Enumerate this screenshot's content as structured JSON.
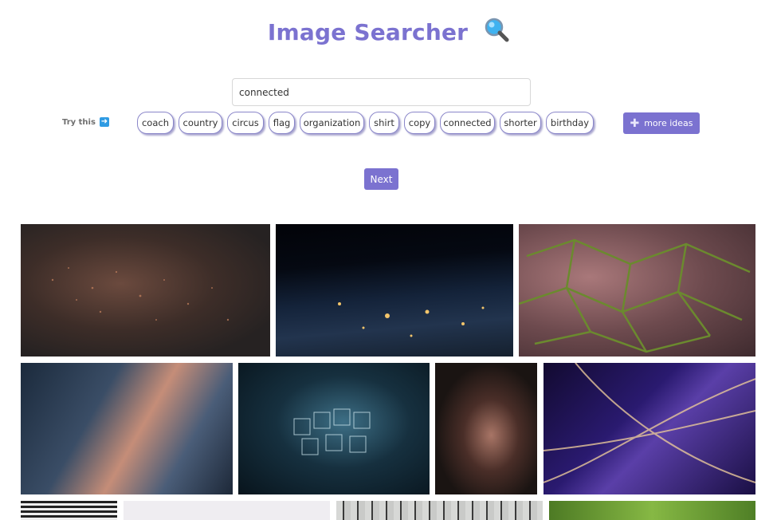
{
  "header": {
    "title": "Image Searcher"
  },
  "search": {
    "value": "connected",
    "placeholder": ""
  },
  "suggestions": {
    "label": "Try this",
    "chips": [
      "coach",
      "country",
      "circus",
      "flag",
      "organization",
      "shirt",
      "copy",
      "connected",
      "shorter",
      "birthday"
    ]
  },
  "more_ideas": {
    "label": "more ideas"
  },
  "pagination": {
    "next_label": "Next"
  },
  "colors": {
    "accent": "#7b72d0",
    "arrow": "#2f9be3"
  }
}
